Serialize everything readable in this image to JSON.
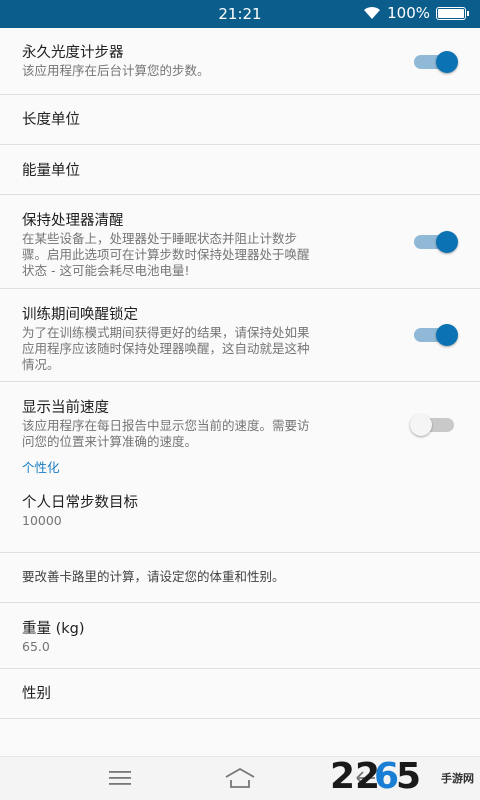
{
  "status_bar": {
    "time": "21:21",
    "battery": "100%"
  },
  "settings": [
    {
      "title": "永久光度计步器",
      "summary": "该应用程序在后台计算您的步数。",
      "toggle": true
    },
    {
      "title": "长度单位"
    },
    {
      "title": "能量单位"
    },
    {
      "title": "保持处理器清醒",
      "summary_lines": [
        "在某些设备上，处理器处于睡眠状态并阻止计数步",
        "骤。启用此选项可在计算步数时保持处理器处于唤醒",
        "状态 - 这可能会耗尽电池电量!"
      ],
      "toggle": true
    },
    {
      "title": "训练期间唤醒锁定",
      "summary_lines": [
        "为了在训练模式期间获得更好的结果，请保持处如果",
        "应用程序应该随时保持处理器唤醒，这自动就是这种",
        "情况。"
      ],
      "toggle": true
    },
    {
      "title": "显示当前速度",
      "summary_lines": [
        "该应用程序在每日报告中显示您当前的速度。需要访",
        "问您的位置来计算准确的速度。"
      ],
      "toggle": false
    }
  ],
  "section": {
    "header": "个性化",
    "daily_goal": {
      "title": "个人日常步数目标",
      "value": "10000"
    },
    "info_text": "要改善卡路里的计算，请设定您的体重和性别。",
    "weight": {
      "title": "重量 (kg)",
      "value": "65.0"
    },
    "gender": {
      "title": "性别"
    }
  },
  "watermark": {
    "brand": "2265",
    "domain": "手游网"
  },
  "colors": {
    "status_bar": "#0b5e8c",
    "accent": "#0b72b4",
    "section_header": "#1b7ec2"
  }
}
